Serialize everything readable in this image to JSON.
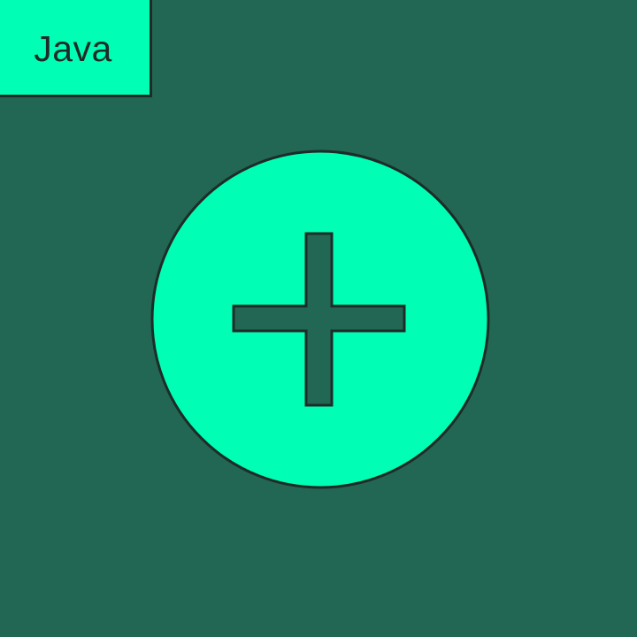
{
  "colors": {
    "background": "#216753",
    "accent": "#00ffb4",
    "outline": "#1e2b27"
  },
  "tag": {
    "label": "Java"
  },
  "main_icon": {
    "name": "plus-circle-icon"
  }
}
